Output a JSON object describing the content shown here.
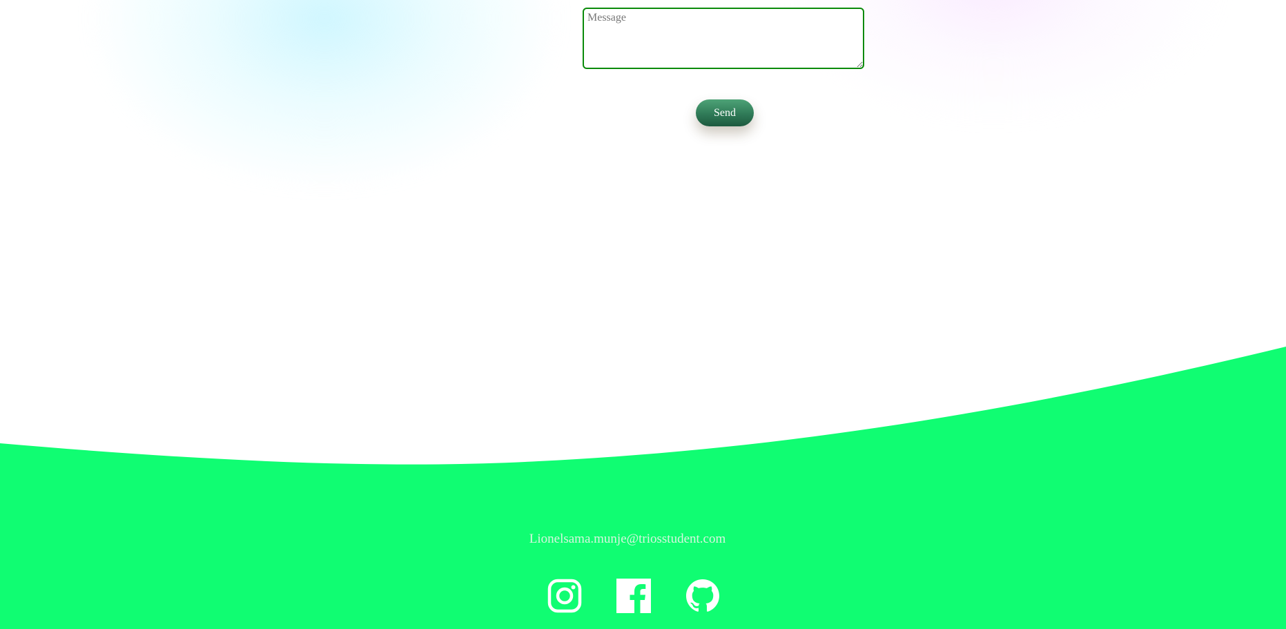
{
  "contact_form": {
    "message_placeholder": "Message",
    "message_value": "",
    "send_label": "Send"
  },
  "footer": {
    "email": "Lionelsama.munje@triosstudent.com",
    "background_color": "#10fd72",
    "social": [
      {
        "name": "instagram",
        "icon": "instagram-icon"
      },
      {
        "name": "facebook",
        "icon": "facebook-icon"
      },
      {
        "name": "github",
        "icon": "github-icon"
      }
    ]
  },
  "colors": {
    "accent_green": "#10fd72",
    "button_green": "#2f7a57",
    "textarea_border": "#0a8a0a"
  }
}
